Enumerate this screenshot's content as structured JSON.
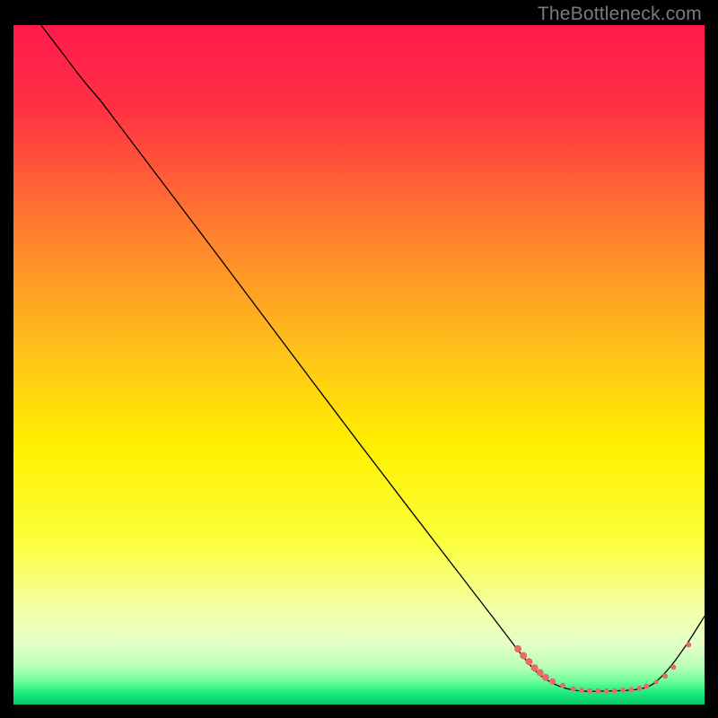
{
  "attribution": "TheBottleneck.com",
  "chart_data": {
    "type": "line",
    "title": "",
    "xlabel": "",
    "ylabel": "",
    "xlim": [
      0,
      100
    ],
    "ylim": [
      0,
      100
    ],
    "grid": false,
    "legend": false,
    "background": {
      "stops": [
        {
          "offset": 0.0,
          "color": "#ff1a4b"
        },
        {
          "offset": 0.12,
          "color": "#ff3044"
        },
        {
          "offset": 0.3,
          "color": "#ff7d2e"
        },
        {
          "offset": 0.48,
          "color": "#ffc21a"
        },
        {
          "offset": 0.62,
          "color": "#fff000"
        },
        {
          "offset": 0.76,
          "color": "#fbff3a"
        },
        {
          "offset": 0.86,
          "color": "#f4ffa8"
        },
        {
          "offset": 0.91,
          "color": "#e5ffc7"
        },
        {
          "offset": 0.945,
          "color": "#b8ffb8"
        },
        {
          "offset": 0.965,
          "color": "#6dff9a"
        },
        {
          "offset": 0.985,
          "color": "#16e87c"
        },
        {
          "offset": 1.0,
          "color": "#0cc76a"
        }
      ]
    },
    "series": [
      {
        "name": "curve",
        "color": "#000000",
        "width": 1.3,
        "points": [
          {
            "x": 4.0,
            "y": 100.0
          },
          {
            "x": 7.0,
            "y": 96.0
          },
          {
            "x": 10.0,
            "y": 92.0
          },
          {
            "x": 12.5,
            "y": 89.0
          },
          {
            "x": 14.0,
            "y": 87.0
          },
          {
            "x": 30.0,
            "y": 65.5
          },
          {
            "x": 50.0,
            "y": 38.5
          },
          {
            "x": 70.0,
            "y": 12.0
          },
          {
            "x": 73.0,
            "y": 8.0
          },
          {
            "x": 76.0,
            "y": 4.5
          },
          {
            "x": 79.0,
            "y": 2.7
          },
          {
            "x": 82.0,
            "y": 2.0
          },
          {
            "x": 86.0,
            "y": 2.0
          },
          {
            "x": 90.0,
            "y": 2.2
          },
          {
            "x": 92.5,
            "y": 3.0
          },
          {
            "x": 95.0,
            "y": 5.5
          },
          {
            "x": 97.5,
            "y": 9.0
          },
          {
            "x": 100.0,
            "y": 13.0
          }
        ]
      }
    ],
    "markers": {
      "color": "#e96a6a",
      "points": [
        {
          "x": 73.0,
          "y": 8.2,
          "r": 4.0
        },
        {
          "x": 73.8,
          "y": 7.2,
          "r": 4.0
        },
        {
          "x": 74.6,
          "y": 6.3,
          "r": 4.0
        },
        {
          "x": 75.4,
          "y": 5.4,
          "r": 4.0
        },
        {
          "x": 76.2,
          "y": 4.7,
          "r": 4.0
        },
        {
          "x": 77.0,
          "y": 4.0,
          "r": 4.0
        },
        {
          "x": 78.0,
          "y": 3.4,
          "r": 3.5
        },
        {
          "x": 79.5,
          "y": 2.8,
          "r": 3.0
        },
        {
          "x": 81.0,
          "y": 2.3,
          "r": 3.0
        },
        {
          "x": 82.2,
          "y": 2.1,
          "r": 3.0
        },
        {
          "x": 83.4,
          "y": 2.0,
          "r": 3.0
        },
        {
          "x": 84.6,
          "y": 2.0,
          "r": 3.0
        },
        {
          "x": 85.8,
          "y": 2.0,
          "r": 3.0
        },
        {
          "x": 87.0,
          "y": 2.0,
          "r": 3.0
        },
        {
          "x": 88.2,
          "y": 2.1,
          "r": 3.0
        },
        {
          "x": 89.4,
          "y": 2.2,
          "r": 3.0
        },
        {
          "x": 90.6,
          "y": 2.4,
          "r": 3.0
        },
        {
          "x": 91.6,
          "y": 2.7,
          "r": 3.0
        },
        {
          "x": 93.0,
          "y": 3.3,
          "r": 2.5
        },
        {
          "x": 94.3,
          "y": 4.2,
          "r": 3.0
        },
        {
          "x": 95.5,
          "y": 5.5,
          "r": 3.0
        },
        {
          "x": 97.7,
          "y": 8.8,
          "r": 3.0
        }
      ]
    }
  }
}
